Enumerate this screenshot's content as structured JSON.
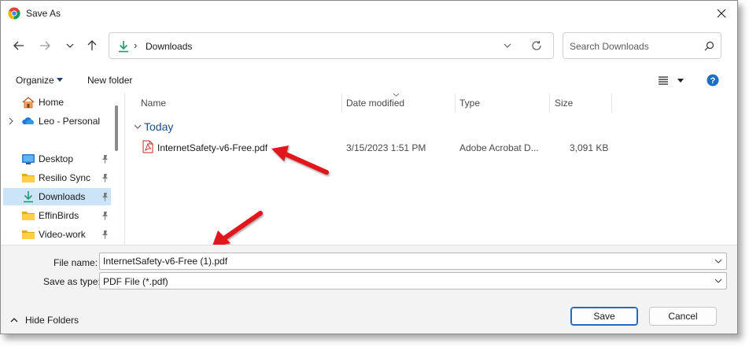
{
  "window": {
    "title": "Save As"
  },
  "address": {
    "location": "Downloads",
    "separator": "›"
  },
  "search": {
    "placeholder": "Search Downloads"
  },
  "commands": {
    "organize": "Organize",
    "new_folder": "New folder"
  },
  "nav": {
    "items": [
      {
        "label": "Home",
        "icon": "home-icon"
      },
      {
        "label": "Leo - Personal",
        "icon": "onedrive-cloud-icon"
      },
      {
        "label": "Desktop",
        "icon": "desktop-icon",
        "pinned": true
      },
      {
        "label": "Resilio Sync",
        "icon": "folder-icon",
        "pinned": true
      },
      {
        "label": "Downloads",
        "icon": "download-icon",
        "pinned": true,
        "selected": true
      },
      {
        "label": "EffinBirds",
        "icon": "folder-icon",
        "pinned": true
      },
      {
        "label": "Video-work",
        "icon": "folder-icon",
        "pinned": true
      }
    ]
  },
  "columns": {
    "name": "Name",
    "date": "Date modified",
    "type": "Type",
    "size": "Size"
  },
  "group": {
    "label": "Today"
  },
  "files": [
    {
      "name": "InternetSafety-v6-Free.pdf",
      "date": "3/15/2023 1:51 PM",
      "type": "Adobe Acrobat D...",
      "size": "3,091 KB"
    }
  ],
  "form": {
    "file_name_label": "File name:",
    "file_name_value": "InternetSafety-v6-Free (1).pdf",
    "save_type_label": "Save as type:",
    "save_type_value": "PDF File (*.pdf)"
  },
  "footer": {
    "hide_folders": "Hide Folders",
    "save": "Save",
    "cancel": "Cancel"
  },
  "colors": {
    "accent": "#1a6fc4",
    "selected_bg": "#cce4f7",
    "arrow": "#e3161b",
    "group_text": "#1a4c8b"
  }
}
